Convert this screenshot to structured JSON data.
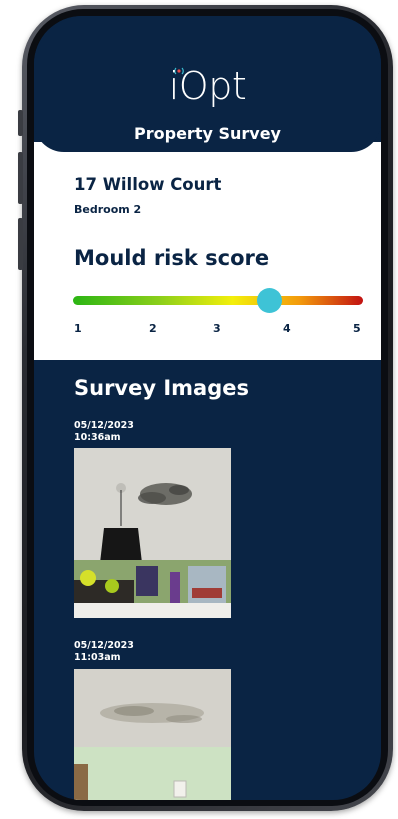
{
  "app": {
    "logo_text": "iOpt",
    "title": "Property Survey"
  },
  "property": {
    "address": "17 Willow Court",
    "room": "Bedroom 2"
  },
  "risk": {
    "title": "Mould risk score",
    "score": 4,
    "min": 1,
    "max": 5,
    "ticks": [
      "1",
      "2",
      "3",
      "4",
      "5"
    ],
    "colors": {
      "low": "#2bb514",
      "mid": "#f3ef0b",
      "high": "#c21212",
      "knob": "#3ec3d6"
    }
  },
  "survey": {
    "title": "Survey Images",
    "images": [
      {
        "date": "05/12/2023",
        "time": "10:36am"
      },
      {
        "date": "05/12/2023",
        "time": "11:03am"
      }
    ]
  },
  "colors": {
    "brand": "#0a2444",
    "text_on_brand": "#ffffff"
  }
}
